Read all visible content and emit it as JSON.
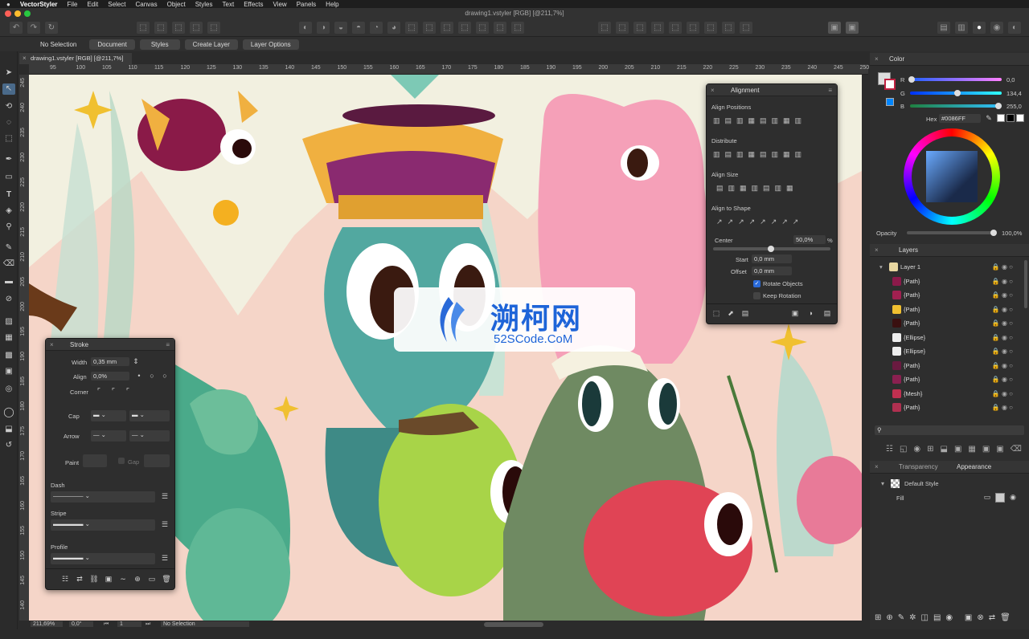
{
  "menubar": {
    "app": "VectorStyler",
    "items": [
      "File",
      "Edit",
      "Select",
      "Canvas",
      "Object",
      "Styles",
      "Text",
      "Effects",
      "View",
      "Panels",
      "Help"
    ]
  },
  "window": {
    "title": "drawing1.vstyler [RGB] [@211,7%]"
  },
  "context_bar": {
    "selection": "No Selection",
    "buttons": [
      "Document",
      "Styles",
      "Create Layer",
      "Layer Options"
    ]
  },
  "doc_tab": {
    "label": "drawing1.vstyler [RGB] [@211,7%]"
  },
  "ruler": {
    "h_ticks": [
      "95",
      "100",
      "105",
      "110",
      "115",
      "120",
      "125",
      "130",
      "135",
      "140",
      "145",
      "150",
      "155",
      "160",
      "165",
      "170",
      "175",
      "180",
      "185",
      "190",
      "195",
      "200",
      "205",
      "210",
      "215",
      "220",
      "225",
      "230",
      "235",
      "240",
      "245",
      "250"
    ],
    "v_ticks": [
      "245",
      "240",
      "235",
      "230",
      "225",
      "220",
      "215",
      "210",
      "205",
      "200",
      "195",
      "190",
      "185",
      "180",
      "175",
      "170",
      "165",
      "160",
      "155",
      "150",
      "145",
      "140"
    ]
  },
  "alignment": {
    "title": "Alignment",
    "align_positions": "Align Positions",
    "distribute": "Distribute",
    "align_size": "Align Size",
    "align_to_shape": "Align to Shape",
    "center_label": "Center",
    "center_value": "50,0%",
    "center_unit": "%",
    "start_label": "Start",
    "start_value": "0,0 mm",
    "offset_label": "Offset",
    "offset_value": "0,0 mm",
    "rotate_objects": "Rotate Objects",
    "rotate_checked": true,
    "keep_rotation": "Keep Rotation"
  },
  "stroke": {
    "title": "Stroke",
    "width_label": "Width",
    "width_value": "0,35 mm",
    "align_label": "Align",
    "align_value": "0,0%",
    "corner_label": "Corner",
    "cap_label": "Cap",
    "arrow_label": "Arrow",
    "paint_label": "Paint",
    "gap_label": "Gap",
    "dash_label": "Dash",
    "stripe_label": "Stripe",
    "profile_label": "Profile"
  },
  "color": {
    "title": "Color",
    "r_label": "R",
    "r_value": "0,0",
    "g_label": "G",
    "g_value": "134,4",
    "b_label": "B",
    "b_value": "255,0",
    "hex_label": "Hex",
    "hex_value": "#0086FF",
    "opacity_label": "Opacity",
    "opacity_value": "100,0%",
    "accent": "#0086FF"
  },
  "layers": {
    "title": "Layers",
    "items": [
      {
        "name": "Layer 1",
        "thumb": "#e8d7a0"
      },
      {
        "name": "{Path}",
        "thumb": "#8b1a4a"
      },
      {
        "name": "{Path}",
        "thumb": "#a02050"
      },
      {
        "name": "{Path}",
        "thumb": "#f0c030"
      },
      {
        "name": "{Path}",
        "thumb": "#3a1010"
      },
      {
        "name": "{Ellipse}",
        "thumb": "#eeeeee"
      },
      {
        "name": "{Ellipse}",
        "thumb": "#eeeeee"
      },
      {
        "name": "{Path}",
        "thumb": "#6a1a40"
      },
      {
        "name": "{Path}",
        "thumb": "#8a2050"
      },
      {
        "name": "{Mesh}",
        "thumb": "#c03050"
      },
      {
        "name": "{Path}",
        "thumb": "#b03050"
      }
    ]
  },
  "appearance": {
    "tab_transparency": "Transparency",
    "tab_appearance": "Appearance",
    "style_name": "Default Style",
    "fill_label": "Fill"
  },
  "status": {
    "zoom": "211,69%",
    "angle": "0,0°",
    "page": "1",
    "selection": "No Selection"
  },
  "watermark": {
    "title": "溯柯网",
    "subtitle": "52SCode.CoM"
  }
}
